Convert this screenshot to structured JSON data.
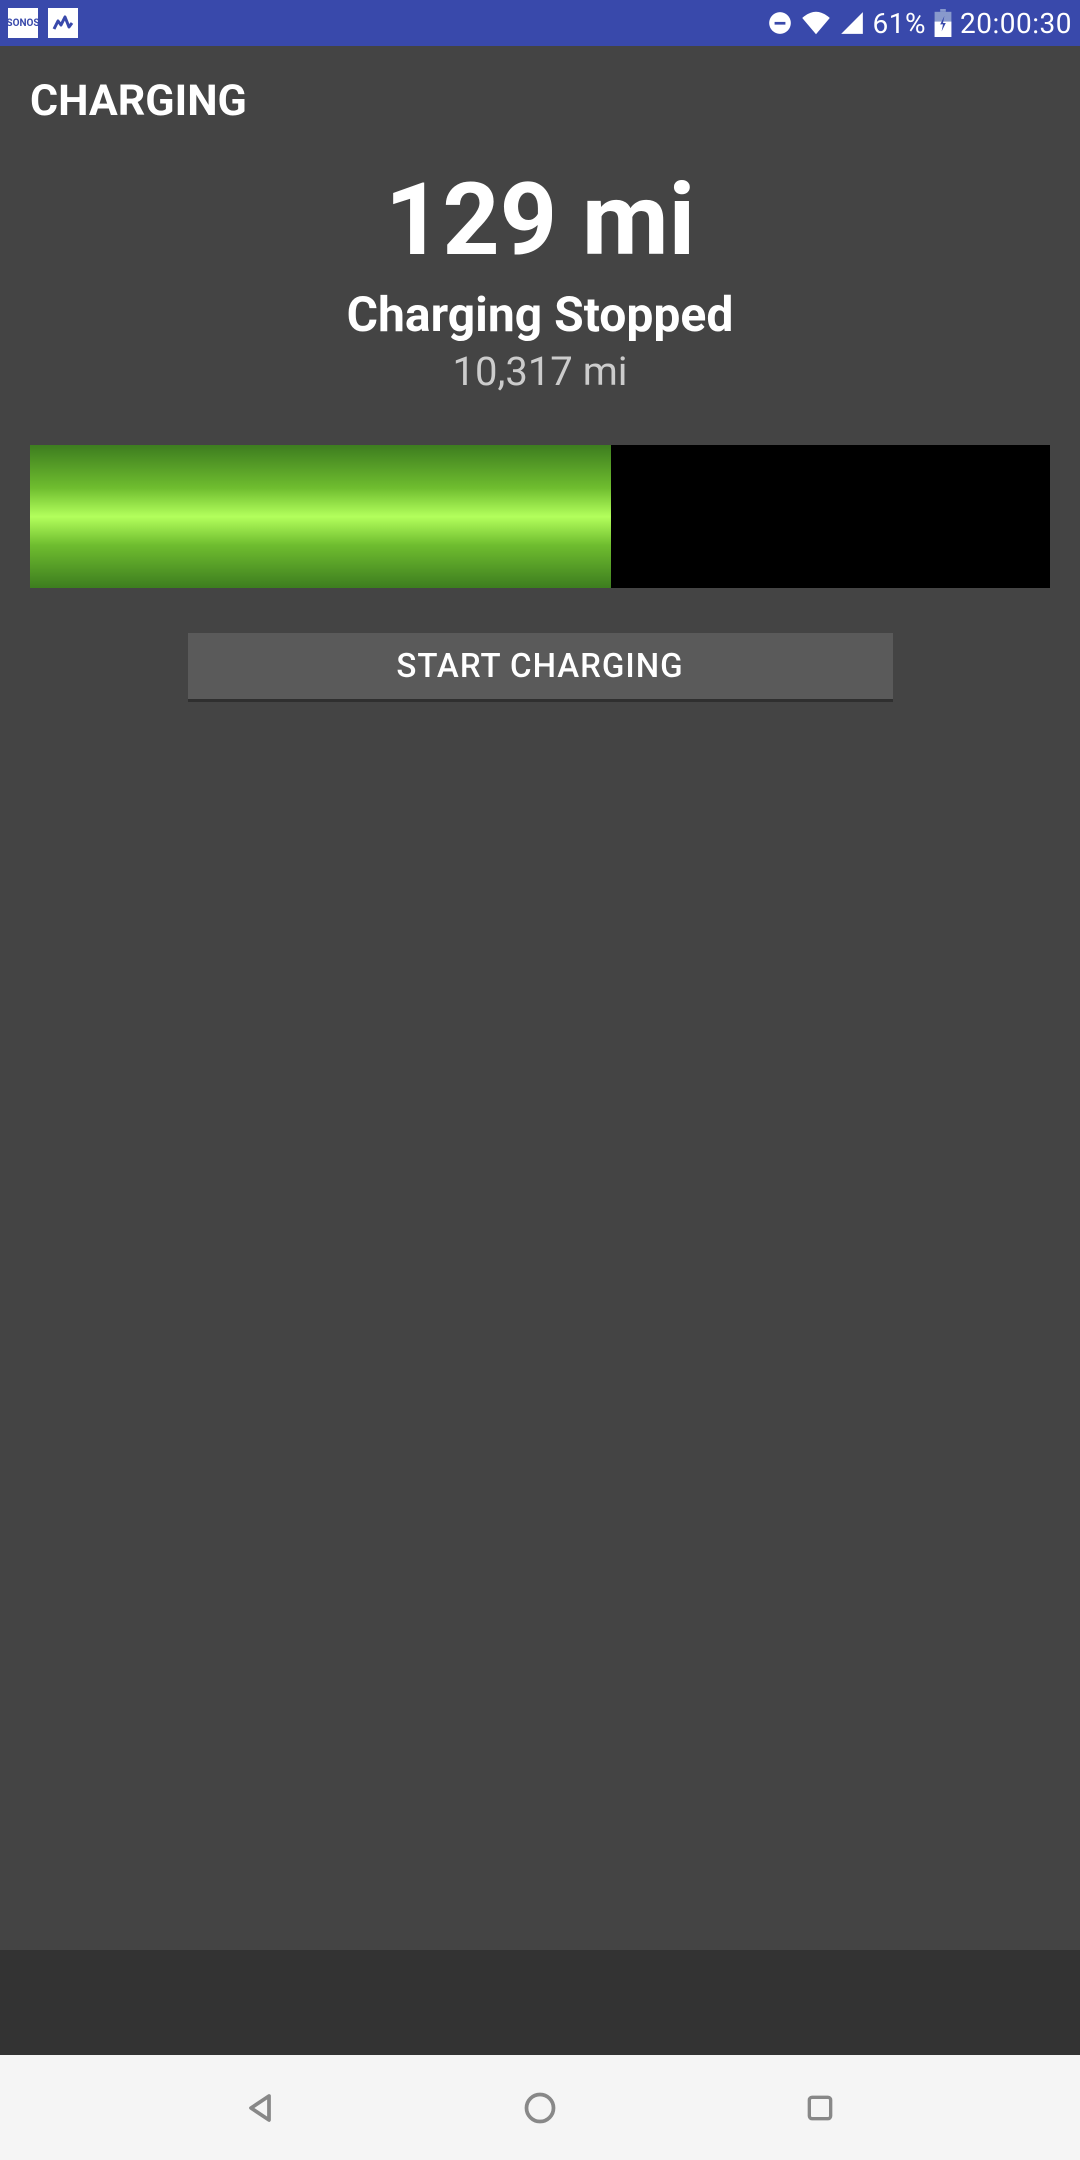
{
  "status_bar": {
    "battery_percent": "61%",
    "time": "20:00:30",
    "sonos_label": "SONOS"
  },
  "page": {
    "title": "CHARGING"
  },
  "charging": {
    "range": "129 mi",
    "status": "Charging Stopped",
    "odometer": "10,317 mi",
    "battery_fill_percent": 57
  },
  "button": {
    "start_label": "START CHARGING"
  }
}
